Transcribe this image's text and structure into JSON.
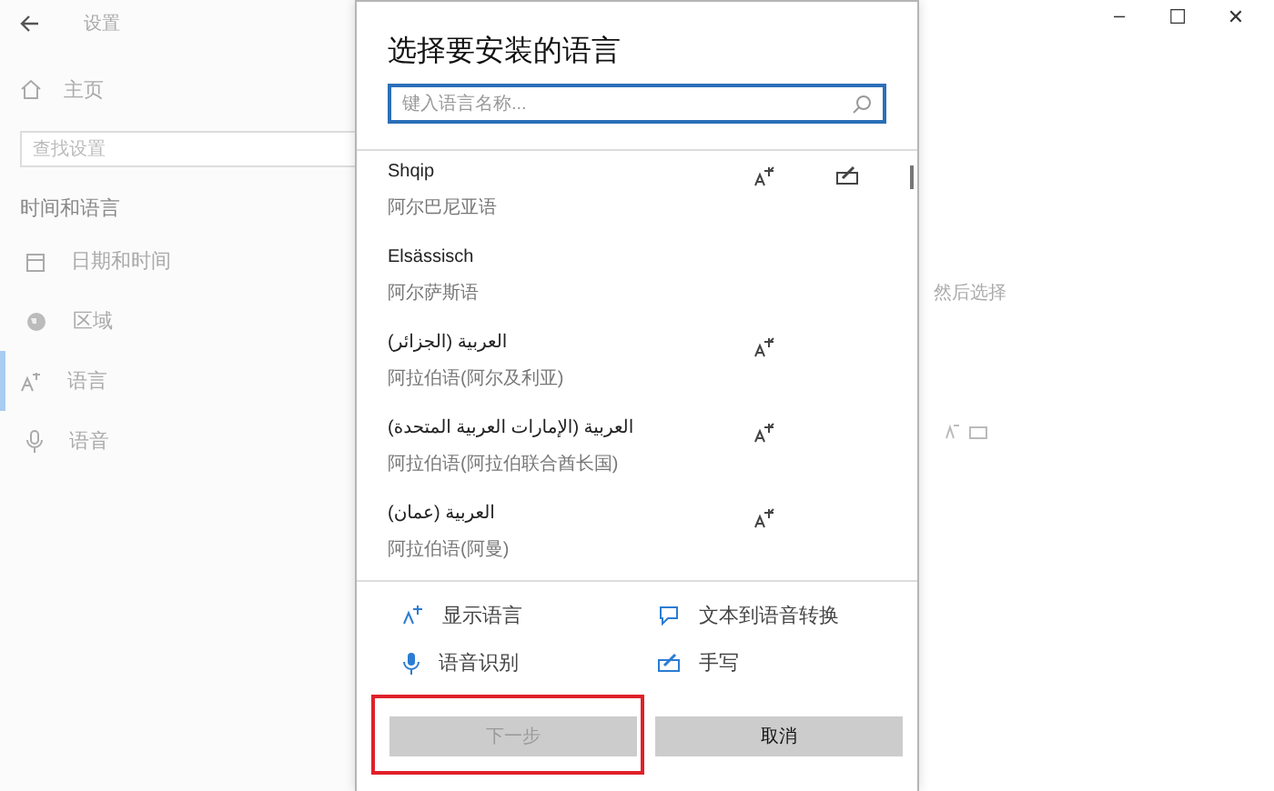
{
  "window": {
    "title": "设置",
    "controls": [
      "–",
      "☐",
      "✕"
    ]
  },
  "sidebar": {
    "home": "主页",
    "search": {
      "placeholder": "查找设置"
    },
    "section": "时间和语言",
    "items": [
      {
        "label": "日期和时间",
        "kind": "calendar",
        "selected": false
      },
      {
        "label": "区域",
        "kind": "globe",
        "selected": false
      },
      {
        "label": "语言",
        "kind": "language",
        "selected": true
      },
      {
        "label": "语音",
        "kind": "mic",
        "selected": false
      }
    ]
  },
  "content": {
    "hint": "然后选择"
  },
  "dialog": {
    "title": "选择要安装的语言",
    "search": {
      "placeholder": "键入语言名称..."
    },
    "languages": [
      {
        "name": "Shqip",
        "subtitle": "阿尔巴尼亚语",
        "display": true,
        "handwriting": true
      },
      {
        "name": "Elsässisch",
        "subtitle": "阿尔萨斯语",
        "display": false,
        "handwriting": false
      },
      {
        "name": "العربية (الجزائر)",
        "subtitle": "阿拉伯语(阿尔及利亚)",
        "display": true,
        "handwriting": false
      },
      {
        "name": "العربية (الإمارات العربية المتحدة)",
        "subtitle": "阿拉伯语(阿拉伯联合酋长国)",
        "display": true,
        "handwriting": false
      },
      {
        "name": "العربية (عمان)",
        "subtitle": "阿拉伯语(阿曼)",
        "display": true,
        "handwriting": false
      }
    ],
    "features": [
      {
        "kind": "display",
        "label": "显示语言"
      },
      {
        "kind": "tts",
        "label": "文本到语音转换"
      },
      {
        "kind": "speech",
        "label": "语音识别"
      },
      {
        "kind": "handwriting",
        "label": "手写"
      }
    ],
    "buttons": [
      {
        "label": "下一步",
        "disabled": true,
        "highlighted": true
      },
      {
        "label": "取消",
        "disabled": false,
        "highlighted": false
      }
    ]
  }
}
